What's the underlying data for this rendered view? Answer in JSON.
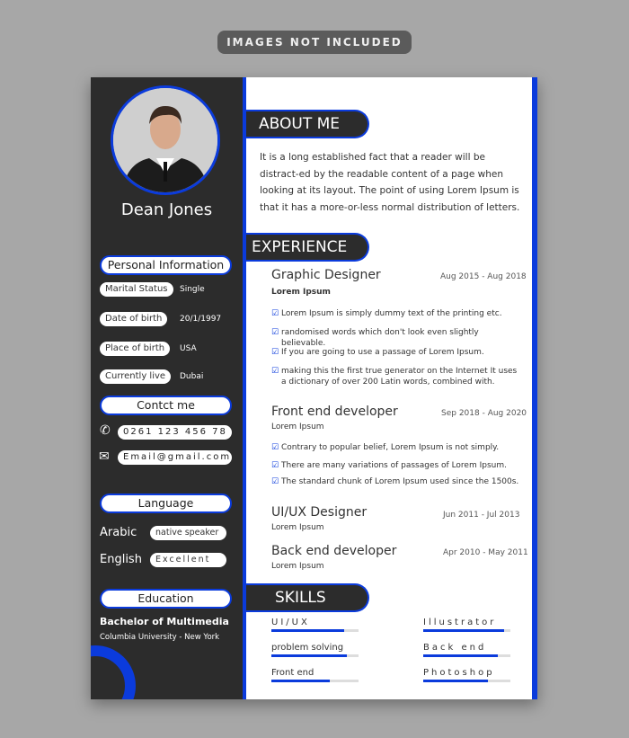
{
  "banner": "IMAGES NOT INCLUDED",
  "name": "Dean Jones",
  "personal": {
    "title": "Personal Information",
    "items": [
      {
        "label": "Marital Status",
        "value": "Single"
      },
      {
        "label": "Date of birth",
        "value": "20/1/1997"
      },
      {
        "label": "Place of birth",
        "value": "USA"
      },
      {
        "label": "Currently live",
        "value": "Dubai"
      }
    ]
  },
  "contact": {
    "title": "Contct me",
    "phone": "0261 123 456 78",
    "email": "Email@gmail.com"
  },
  "language": {
    "title": "Language",
    "items": [
      {
        "name": "Arabic",
        "level": "native speaker"
      },
      {
        "name": "English",
        "level": "Excellent"
      }
    ]
  },
  "education": {
    "title": "Education",
    "degree": "Bachelor of Multimedia",
    "school": "Columbia University - New York"
  },
  "about": {
    "title": "ABOUT ME",
    "text": "It is a long established fact that a reader will be distract-ed by the readable content of a page when looking at its layout. The point of using Lorem Ipsum is that it has a more-or-less normal distribution of letters."
  },
  "experience": {
    "title": "EXPERIENCE",
    "jobs": [
      {
        "title": "Graphic Designer",
        "dates": "Aug 2015 - Aug 2018",
        "company": "Lorem Ipsum",
        "bullets": [
          "Lorem Ipsum is simply dummy text of the printing etc.",
          "randomised words which don't look even slightly believable.",
          "If you are going to use a passage of Lorem Ipsum.",
          "making this the first true generator on the Internet It uses a dictionary of over 200 Latin words, combined with."
        ]
      },
      {
        "title": "Front end developer",
        "dates": "Sep 2018 - Aug 2020",
        "company": "Lorem Ipsum",
        "bullets": [
          "Contrary to popular belief, Lorem Ipsum is not simply.",
          "There are many variations of passages of Lorem Ipsum.",
          "The standard chunk of Lorem Ipsum used since the 1500s."
        ]
      },
      {
        "title": "UI/UX Designer",
        "dates": "Jun 2011  - Jul 2013",
        "company": "Lorem Ipsum",
        "bullets": []
      },
      {
        "title": "Back end developer",
        "dates": "Apr 2010  - May 2011",
        "company": "Lorem Ipsum",
        "bullets": []
      }
    ]
  },
  "skills": {
    "title": "SKILLS",
    "items": [
      {
        "name": "UI/UX",
        "level": 0.83
      },
      {
        "name": "Illustrator",
        "level": 0.93
      },
      {
        "name": "problem solving",
        "level": 0.87
      },
      {
        "name": "Back end",
        "level": 0.86
      },
      {
        "name": "Front end",
        "level": 0.67
      },
      {
        "name": "Photoshop",
        "level": 0.74
      }
    ]
  },
  "colors": {
    "accent": "#0b3bdc",
    "dark": "#2c2c2c"
  }
}
